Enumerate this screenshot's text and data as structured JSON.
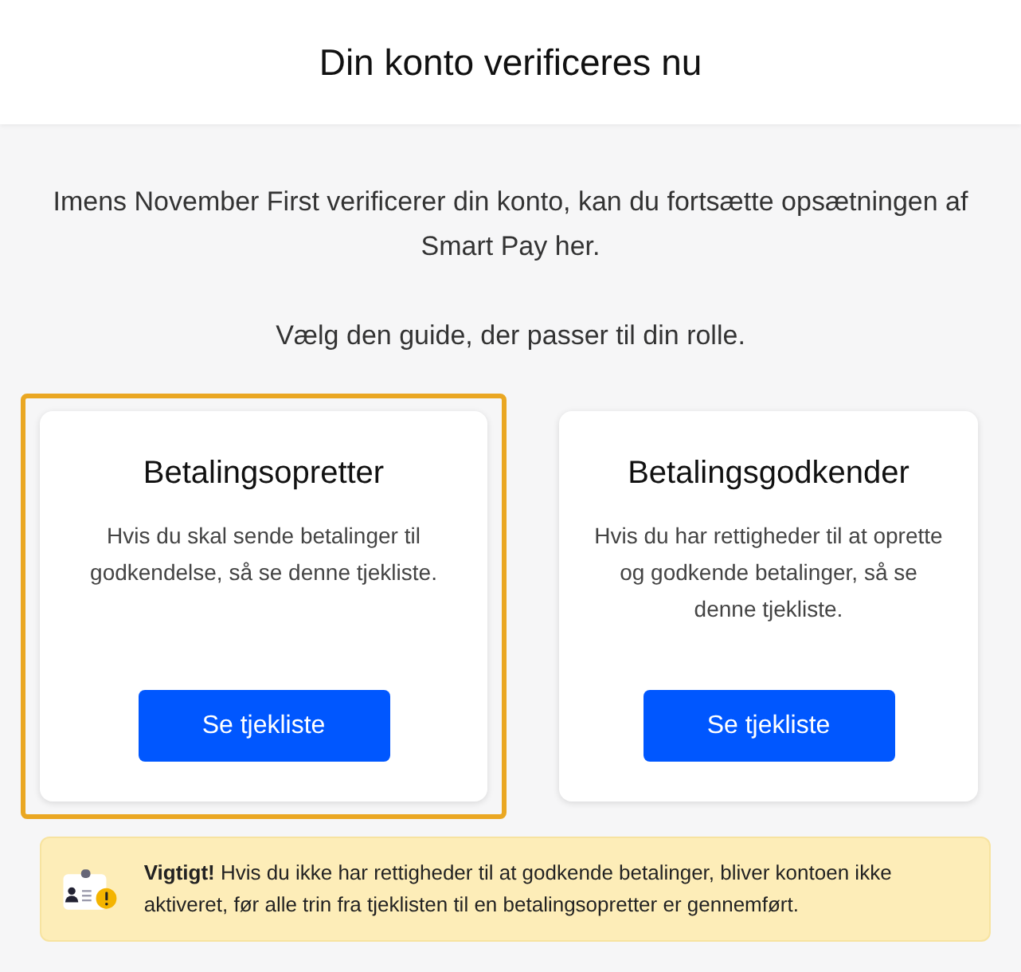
{
  "header": {
    "title": "Din konto verificeres nu"
  },
  "intro": "Imens November First verificerer din konto, kan du fortsætte opsætningen af Smart Pay her.",
  "prompt": "Vælg den guide, der passer til din rolle.",
  "cards": [
    {
      "title": "Betalingsopretter",
      "text": "Hvis du skal sende betalinger til godkendelse, så se denne tjekliste.",
      "button": "Se tjekliste",
      "selected": true
    },
    {
      "title": "Betalingsgodkender",
      "text": "Hvis du har rettigheder til at oprette og godkende betalinger, så se denne tjekliste.",
      "button": "Se tjekliste",
      "selected": false
    }
  ],
  "notice": {
    "text": "**Vigtigt!** Hvis du ikke har rettigheder til at godkende betalinger, bliver kontoen ikke aktiveret, før alle trin fra tjeklisten til en betalingsopretter er gennemført."
  }
}
